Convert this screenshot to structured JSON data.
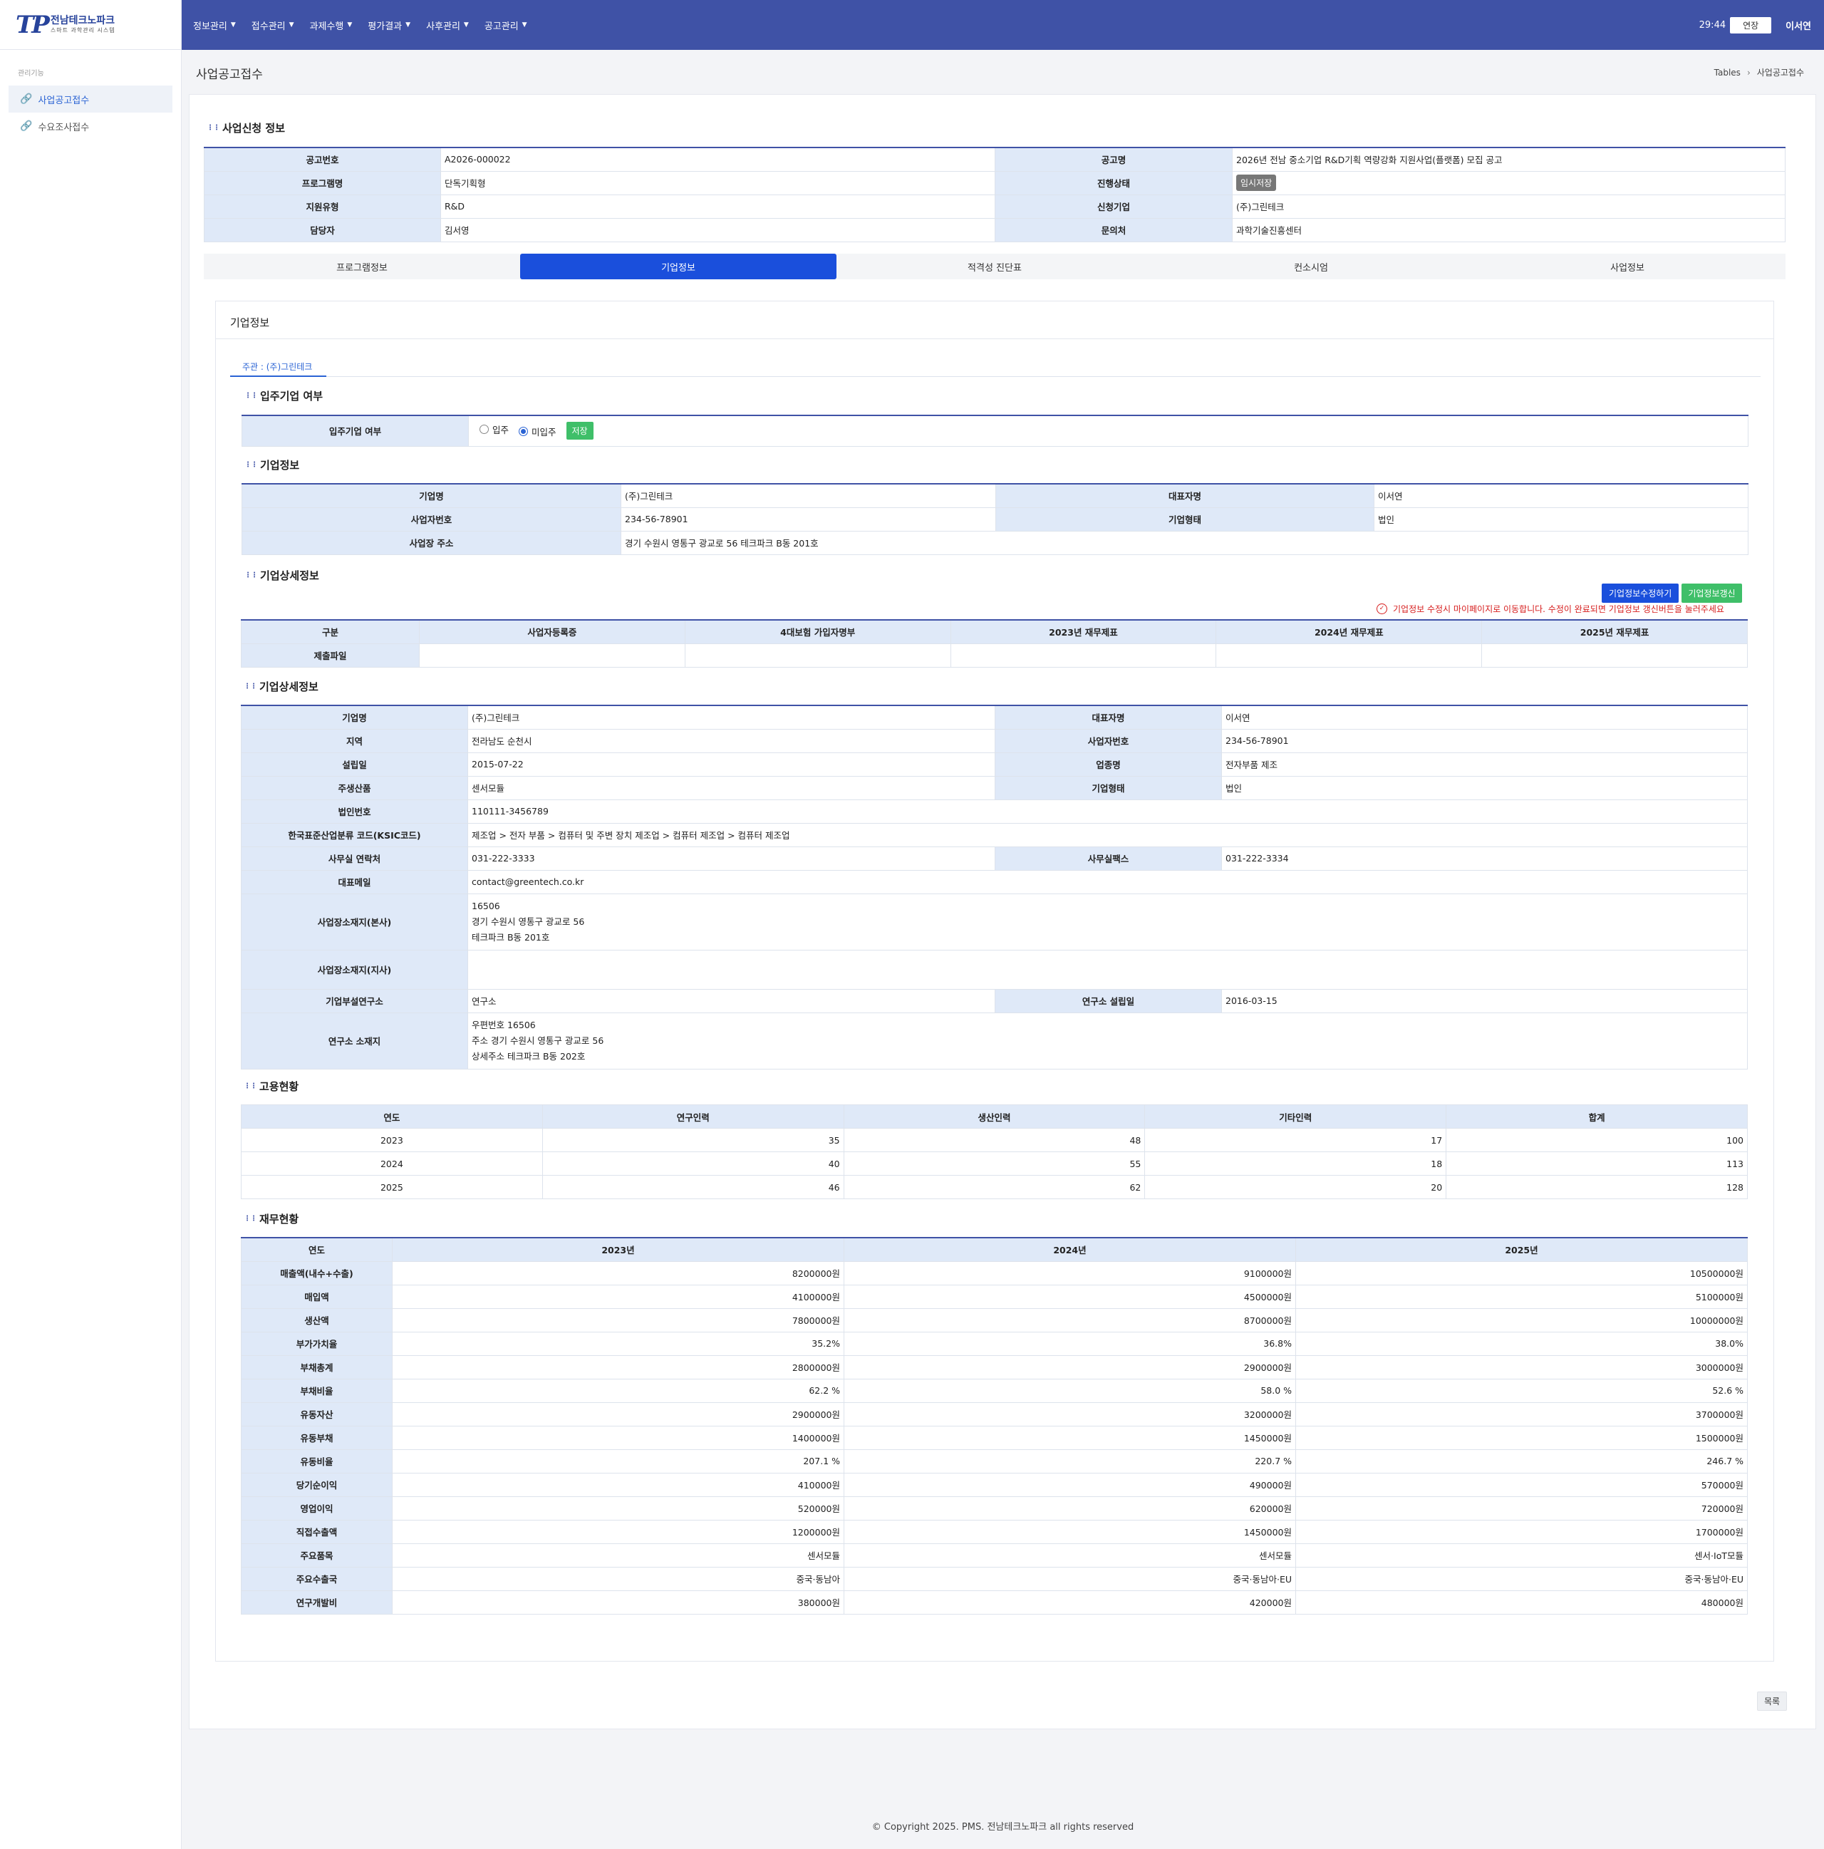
{
  "header": {
    "logo_mark": "TP",
    "logo_title": "전남테크노파크",
    "logo_sub": "스마트 과학관리 시스템",
    "nav": [
      "정보관리",
      "접수관리",
      "과제수행",
      "평가결과",
      "사후관리",
      "공고관리"
    ],
    "timer": "29:44",
    "extend": "연장",
    "user": "이서연"
  },
  "sidebar": {
    "title": "관리기능",
    "items": [
      "사업공고접수",
      "수요조사접수"
    ]
  },
  "page": {
    "title": "사업공고접수",
    "breadcrumb": [
      "Tables",
      "사업공고접수"
    ]
  },
  "application": {
    "title": "사업신청 정보",
    "rows": [
      [
        "공고번호",
        "A2026-000022",
        "공고명",
        "2026년 전남 중소기업 R&D기획 역량강화 지원사업(플랫폼) 모집 공고"
      ],
      [
        "프로그램명",
        "단독기획형",
        "진행상태",
        "임시저장"
      ],
      [
        "지원유형",
        "R&D",
        "신청기업",
        "(주)그린테크"
      ],
      [
        "담당자",
        "김서영",
        "문의처",
        "과학기술진흥센터"
      ]
    ]
  },
  "tabs": [
    "프로그램정보",
    "기업정보",
    "적격성 진단표",
    "컨소시엄",
    "사업정보"
  ],
  "company": {
    "panel_title": "기업정보",
    "subtab": "주관 : (주)그린테크",
    "residency": {
      "title": "입주기업 여부",
      "label": "입주기업 여부",
      "options": [
        "입주",
        "미입주"
      ],
      "selected": "미입주",
      "save": "저장"
    },
    "basic": {
      "title": "기업정보",
      "name_label": "기업명",
      "name": "(주)그린테크",
      "ceo_label": "대표자명",
      "ceo": "이서연",
      "bizno_label": "사업자번호",
      "bizno": "234-56-78901",
      "type_label": "기업형태",
      "type": "법인",
      "addr_label": "사업장 주소",
      "addr": "경기 수원시 영통구 광교로 56 테크파크 B동 201호"
    },
    "files": {
      "title": "기업상세정보",
      "edit_btn": "기업정보수정하기",
      "refresh_btn": "기업정보갱신",
      "notice": "기업정보 수정시 마이페이지로 이동합니다. 수정이 완료되면 기업정보 갱신버튼을 눌러주세요",
      "headers": [
        "구분",
        "사업자등록증",
        "4대보험 가입자명부",
        "2023년 재무제표",
        "2024년 재무제표",
        "2025년 재무제표"
      ],
      "row_label": "제출파일"
    },
    "detail": {
      "title": "기업상세정보",
      "l": {
        "name": "기업명",
        "region": "지역",
        "founded": "설립일",
        "product": "주생산품",
        "corpno": "법인번호",
        "ksic": "한국표준산업분류 코드(KSIC코드)",
        "phone": "사무실 연락처",
        "email": "대표메일",
        "hq": "사업장소재지(본사)",
        "branch": "사업장소재지(지사)",
        "lab": "기업부설연구소",
        "labaddr": "연구소 소재지",
        "ceo": "대표자명",
        "bizno": "사업자번호",
        "industry": "업종명",
        "ctype": "기업형태",
        "fax": "사무실팩스",
        "labdate": "연구소 설립일"
      },
      "v": {
        "name": "(주)그린테크",
        "region": "전라남도 순천시",
        "founded": "2015-07-22",
        "product": "센서모듈",
        "corpno": "110111-3456789",
        "ksic": "제조업 > 전자 부품 > 컴퓨터 및 주변 장치 제조업 > 컴퓨터 제조업 > 컴퓨터 제조업",
        "phone": "031-222-3333",
        "email": "contact@greentech.co.kr",
        "hq": [
          "16506",
          "경기 수원시 영통구 광교로 56",
          "테크파크 B동 201호"
        ],
        "lab": "연구소",
        "labaddr": [
          "우편번호 16506",
          "주소 경기 수원시 영통구 광교로 56",
          "상세주소 테크파크 B동 202호"
        ],
        "ceo": "이서연",
        "bizno": "234-56-78901",
        "industry": "전자부품 제조",
        "ctype": "법인",
        "fax": "031-222-3334",
        "labdate": "2016-03-15"
      }
    },
    "employment": {
      "title": "고용현황",
      "headers": [
        "연도",
        "연구인력",
        "생산인력",
        "기타인력",
        "합계"
      ],
      "rows": [
        [
          "2023",
          "35",
          "48",
          "17",
          "100"
        ],
        [
          "2024",
          "40",
          "55",
          "18",
          "113"
        ],
        [
          "2025",
          "46",
          "62",
          "20",
          "128"
        ]
      ]
    },
    "finance": {
      "title": "재무현황",
      "headers": [
        "연도",
        "2023년",
        "2024년",
        "2025년"
      ],
      "rows": [
        [
          "매출액(내수+수출)",
          "8200000원",
          "9100000원",
          "10500000원"
        ],
        [
          "매입액",
          "4100000원",
          "4500000원",
          "5100000원"
        ],
        [
          "생산액",
          "7800000원",
          "8700000원",
          "10000000원"
        ],
        [
          "부가가치율",
          "35.2%",
          "36.8%",
          "38.0%"
        ],
        [
          "부채총계",
          "2800000원",
          "2900000원",
          "3000000원"
        ],
        [
          "부채비율",
          "62.2 %",
          "58.0 %",
          "52.6 %"
        ],
        [
          "유동자산",
          "2900000원",
          "3200000원",
          "3700000원"
        ],
        [
          "유동부채",
          "1400000원",
          "1450000원",
          "1500000원"
        ],
        [
          "유동비율",
          "207.1 %",
          "220.7 %",
          "246.7 %"
        ],
        [
          "당기순이익",
          "410000원",
          "490000원",
          "570000원"
        ],
        [
          "영업이익",
          "520000원",
          "620000원",
          "720000원"
        ],
        [
          "직접수출액",
          "1200000원",
          "1450000원",
          "1700000원"
        ],
        [
          "주요품목",
          "센서모듈",
          "센서모듈",
          "센서·IoT모듈"
        ],
        [
          "주요수출국",
          "중국·동남아",
          "중국·동남아·EU",
          "중국·동남아·EU"
        ],
        [
          "연구개발비",
          "380000원",
          "420000원",
          "480000원"
        ]
      ]
    }
  },
  "list_btn": "목록",
  "footer": "© Copyright 2025. PMS. 전남테크노파크 all rights reserved"
}
